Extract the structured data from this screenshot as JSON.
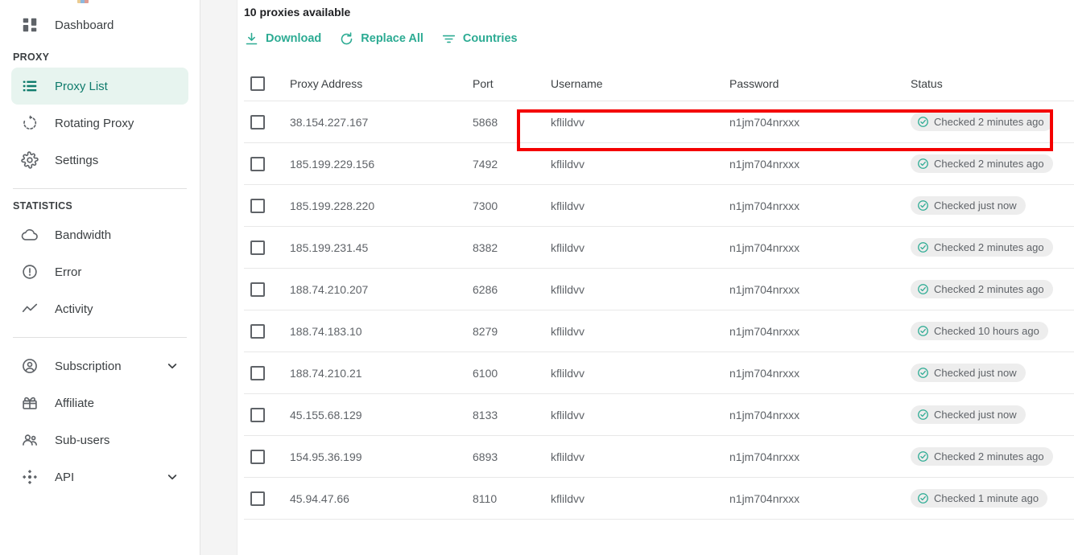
{
  "sidebar": {
    "items_top": [
      {
        "label": "Dashboard",
        "icon": "dashboard-grid-icon",
        "name": "dashboard",
        "active": false,
        "chevron": false
      }
    ],
    "sections": [
      {
        "title": "PROXY",
        "items": [
          {
            "label": "Proxy List",
            "icon": "list-icon",
            "name": "proxy-list",
            "active": true,
            "chevron": false
          },
          {
            "label": "Rotating Proxy",
            "icon": "refresh-rotate-icon",
            "name": "rotating-proxy",
            "active": false,
            "chevron": false
          },
          {
            "label": "Settings",
            "icon": "gear-icon",
            "name": "settings",
            "active": false,
            "chevron": false
          }
        ]
      },
      {
        "title": "STATISTICS",
        "items": [
          {
            "label": "Bandwidth",
            "icon": "cloud-icon",
            "name": "bandwidth",
            "active": false,
            "chevron": false
          },
          {
            "label": "Error",
            "icon": "alert-circle-icon",
            "name": "error",
            "active": false,
            "chevron": false
          },
          {
            "label": "Activity",
            "icon": "trend-line-icon",
            "name": "activity",
            "active": false,
            "chevron": false
          }
        ]
      },
      {
        "title": "",
        "items": [
          {
            "label": "Subscription",
            "icon": "account-circle-icon",
            "name": "subscription",
            "active": false,
            "chevron": true
          },
          {
            "label": "Affiliate",
            "icon": "gift-icon",
            "name": "affiliate",
            "active": false,
            "chevron": false
          },
          {
            "label": "Sub-users",
            "icon": "people-icon",
            "name": "sub-users",
            "active": false,
            "chevron": false
          },
          {
            "label": "API",
            "icon": "api-nodes-icon",
            "name": "api",
            "active": false,
            "chevron": true
          }
        ]
      }
    ]
  },
  "main": {
    "count_text": "10 proxies available",
    "toolbar": [
      {
        "label": "Download",
        "icon": "download-icon",
        "name": "download-button"
      },
      {
        "label": "Replace All",
        "icon": "refresh-icon",
        "name": "replace-all-button"
      },
      {
        "label": "Countries",
        "icon": "filter-icon",
        "name": "countries-button"
      }
    ],
    "table": {
      "columns": [
        "Proxy Address",
        "Port",
        "Username",
        "Password",
        "Status"
      ],
      "rows": [
        {
          "address": "38.154.227.167",
          "port": "5868",
          "username": "kflildvv",
          "password": "n1jm704nrxxx",
          "status": "Checked 2 minutes ago",
          "checked": false,
          "highlighted": true
        },
        {
          "address": "185.199.229.156",
          "port": "7492",
          "username": "kflildvv",
          "password": "n1jm704nrxxx",
          "status": "Checked 2 minutes ago",
          "checked": false,
          "highlighted": false
        },
        {
          "address": "185.199.228.220",
          "port": "7300",
          "username": "kflildvv",
          "password": "n1jm704nrxxx",
          "status": "Checked just now",
          "checked": false,
          "highlighted": false
        },
        {
          "address": "185.199.231.45",
          "port": "8382",
          "username": "kflildvv",
          "password": "n1jm704nrxxx",
          "status": "Checked 2 minutes ago",
          "checked": false,
          "highlighted": false
        },
        {
          "address": "188.74.210.207",
          "port": "6286",
          "username": "kflildvv",
          "password": "n1jm704nrxxx",
          "status": "Checked 2 minutes ago",
          "checked": false,
          "highlighted": false
        },
        {
          "address": "188.74.183.10",
          "port": "8279",
          "username": "kflildvv",
          "password": "n1jm704nrxxx",
          "status": "Checked 10 hours ago",
          "checked": false,
          "highlighted": false
        },
        {
          "address": "188.74.210.21",
          "port": "6100",
          "username": "kflildvv",
          "password": "n1jm704nrxxx",
          "status": "Checked just now",
          "checked": false,
          "highlighted": false
        },
        {
          "address": "45.155.68.129",
          "port": "8133",
          "username": "kflildvv",
          "password": "n1jm704nrxxx",
          "status": "Checked just now",
          "checked": false,
          "highlighted": false
        },
        {
          "address": "154.95.36.199",
          "port": "6893",
          "username": "kflildvv",
          "password": "n1jm704nrxxx",
          "status": "Checked 2 minutes ago",
          "checked": false,
          "highlighted": false
        },
        {
          "address": "45.94.47.66",
          "port": "8110",
          "username": "kflildvv",
          "password": "n1jm704nrxxx",
          "status": "Checked 1 minute ago",
          "checked": false,
          "highlighted": false
        }
      ],
      "select_all_checked": false
    }
  },
  "colors": {
    "accent": "#2cab93",
    "active_nav_bg": "#e7f4ef",
    "active_nav_text": "#0f7b6c",
    "badge_bg": "#ededed",
    "status_check": "#2cab93",
    "highlight_border": "#f40000"
  }
}
